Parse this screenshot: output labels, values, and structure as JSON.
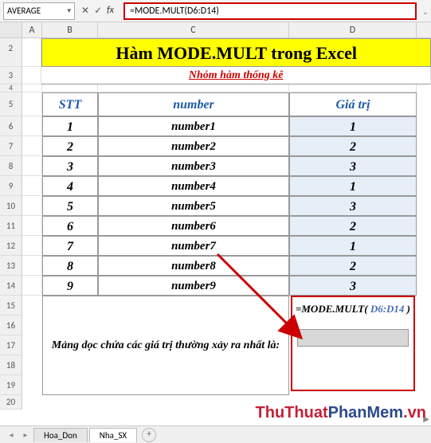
{
  "formula_bar": {
    "name_box": "AVERAGE",
    "fx_label": "fx",
    "formula": "=MODE.MULT(D6:D14)"
  },
  "columns": [
    "A",
    "B",
    "C",
    "D"
  ],
  "title": "Hàm MODE.MULT trong Excel",
  "subtitle": "Nhóm hàm thống kê",
  "headers": {
    "stt": "STT",
    "number": "number",
    "value": "Giá trị"
  },
  "rows": [
    {
      "r": "6",
      "stt": "1",
      "num": "number1",
      "val": "1"
    },
    {
      "r": "7",
      "stt": "2",
      "num": "number2",
      "val": "2"
    },
    {
      "r": "8",
      "stt": "3",
      "num": "number3",
      "val": "3"
    },
    {
      "r": "9",
      "stt": "4",
      "num": "number4",
      "val": "1"
    },
    {
      "r": "10",
      "stt": "5",
      "num": "number5",
      "val": "3"
    },
    {
      "r": "11",
      "stt": "6",
      "num": "number6",
      "val": "2"
    },
    {
      "r": "12",
      "stt": "7",
      "num": "number7",
      "val": "1"
    },
    {
      "r": "13",
      "stt": "8",
      "num": "number8",
      "val": "2"
    },
    {
      "r": "14",
      "stt": "9",
      "num": "number9",
      "val": "3"
    }
  ],
  "merged_text": "Mảng dọc chứa các giá trị thường xảy ra nhất là:",
  "callout": {
    "prefix": "=MODE.MULT( ",
    "ref": "D6:D14",
    "suffix": " )"
  },
  "row_labels": {
    "r2": "2",
    "r3": "3",
    "r4": "4",
    "r5": "5",
    "r15": "15",
    "r16": "16",
    "r17": "17",
    "r18": "18",
    "r19": "19",
    "r20": "20"
  },
  "tabs": {
    "t1": "Hoa_Don",
    "t2": "Nha_SX",
    "add": "+"
  },
  "watermark": {
    "a": "ThuThuat",
    "b": "PhanMem",
    "c": ".vn"
  }
}
